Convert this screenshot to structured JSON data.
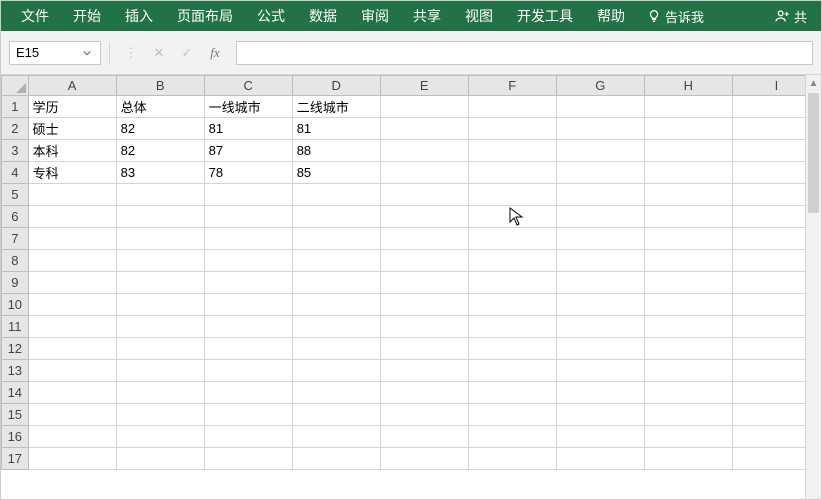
{
  "menu": {
    "items": [
      "文件",
      "开始",
      "插入",
      "页面布局",
      "公式",
      "数据",
      "审阅",
      "共享",
      "视图",
      "开发工具",
      "帮助"
    ],
    "tellme": "告诉我",
    "share": "共"
  },
  "formula_bar": {
    "namebox": "E15",
    "cancel": "✕",
    "confirm": "✓",
    "fx": "fx",
    "formula": ""
  },
  "cols": [
    "A",
    "B",
    "C",
    "D",
    "E",
    "F",
    "G",
    "H",
    "I"
  ],
  "rows_count": 17,
  "data": {
    "r1": {
      "A": "学历",
      "B": "总体",
      "C": "一线城市",
      "D": "二线城市"
    },
    "r2": {
      "A": "硕士",
      "B": "82",
      "C": "81",
      "D": "81"
    },
    "r3": {
      "A": "本科",
      "B": "82",
      "C": "87",
      "D": "88"
    },
    "r4": {
      "A": "专科",
      "B": "83",
      "C": "78",
      "D": "85"
    }
  },
  "chart_data": {
    "type": "table",
    "title": "",
    "columns": [
      "学历",
      "总体",
      "一线城市",
      "二线城市"
    ],
    "rows": [
      {
        "学历": "硕士",
        "总体": 82,
        "一线城市": 81,
        "二线城市": 81
      },
      {
        "学历": "本科",
        "总体": 82,
        "一线城市": 87,
        "二线城市": 88
      },
      {
        "学历": "专科",
        "总体": 83,
        "一线城市": 78,
        "二线城市": 85
      }
    ]
  }
}
